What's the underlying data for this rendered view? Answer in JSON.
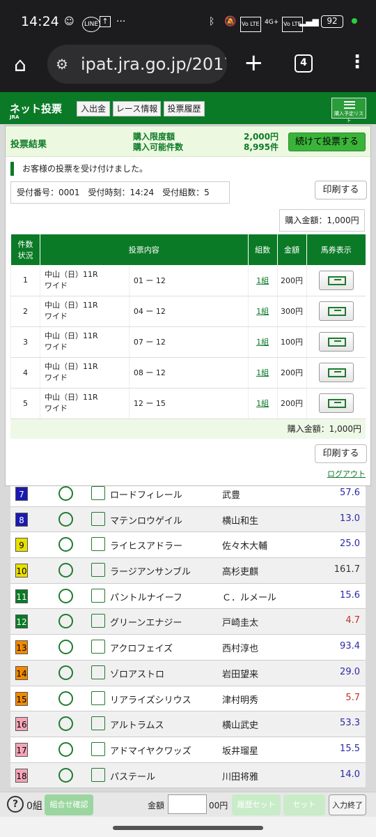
{
  "status": {
    "time": "14:24",
    "battery": "92",
    "net": "4G+"
  },
  "browser": {
    "url": "ipat.jra.go.jp/2017/p",
    "tab_count": "4"
  },
  "jra": {
    "logo": "ネット投票",
    "logo_sub": "JRA",
    "nav": [
      "入出金",
      "レース情報",
      "投票履歴"
    ],
    "list_btn": "購入予定リスト"
  },
  "modal": {
    "title": "投票結果",
    "limit_label": "購入限度額",
    "limit_value": "2,000円",
    "avail_label": "購入可能件数",
    "avail_value": "8,995件",
    "continue_btn": "続けて投票する",
    "accepted": "お客様の投票を受け付けました。",
    "receipt": "受付番号：0001　受付時刻：14:24　受付組数：5",
    "print_btn": "印刷する",
    "amount": "購入金額：1,000円",
    "headers": {
      "n1": "件数",
      "n2": "状況",
      "bet": "投票内容",
      "kumi": "組数",
      "amt": "金額",
      "view": "馬券表示"
    },
    "rows": [
      {
        "n": "1",
        "race": "中山（日）11R",
        "type": "ワイド",
        "combo": "01 ー 12",
        "kumi": "1組",
        "amt": "200円"
      },
      {
        "n": "2",
        "race": "中山（日）11R",
        "type": "ワイド",
        "combo": "04 ー 12",
        "kumi": "1組",
        "amt": "300円"
      },
      {
        "n": "3",
        "race": "中山（日）11R",
        "type": "ワイド",
        "combo": "07 ー 12",
        "kumi": "1組",
        "amt": "100円"
      },
      {
        "n": "4",
        "race": "中山（日）11R",
        "type": "ワイド",
        "combo": "08 ー 12",
        "kumi": "1組",
        "amt": "200円"
      },
      {
        "n": "5",
        "race": "中山（日）11R",
        "type": "ワイド",
        "combo": "12 ー 15",
        "kumi": "1組",
        "amt": "200円"
      }
    ],
    "total": "購入金額：1,000円",
    "print_btn2": "印刷する",
    "logout": "ログアウト"
  },
  "horses": [
    {
      "n": "7",
      "name": "ロードフィレール",
      "jockey": "武豊",
      "odds": "57.6",
      "color": "#1a1ab0",
      "textcolor": "#fff",
      "oddscolor": "#2a2aa8"
    },
    {
      "n": "8",
      "name": "マテンロウゲイル",
      "jockey": "横山和生",
      "odds": "13.0",
      "color": "#1a1ab0",
      "textcolor": "#fff",
      "oddscolor": "#2a2aa8"
    },
    {
      "n": "9",
      "name": "ライヒスアドラー",
      "jockey": "佐々木大輔",
      "odds": "25.0",
      "color": "#e8e000",
      "textcolor": "#000",
      "oddscolor": "#2a2aa8"
    },
    {
      "n": "10",
      "name": "ラージアンサンブル",
      "jockey": "高杉吏麒",
      "odds": "161.7",
      "color": "#e8e000",
      "textcolor": "#000",
      "oddscolor": "#333"
    },
    {
      "n": "11",
      "name": "パントルナイーフ",
      "jockey": "Ｃ．ルメール",
      "odds": "15.6",
      "color": "#0b7a27",
      "textcolor": "#fff",
      "oddscolor": "#2a2aa8"
    },
    {
      "n": "12",
      "name": "グリーンエナジー",
      "jockey": "戸崎圭太",
      "odds": "4.7",
      "color": "#0b7a27",
      "textcolor": "#fff",
      "oddscolor": "#c0302a"
    },
    {
      "n": "13",
      "name": "アクロフェイズ",
      "jockey": "西村淳也",
      "odds": "93.4",
      "color": "#f08a00",
      "textcolor": "#000",
      "oddscolor": "#2a2aa8"
    },
    {
      "n": "14",
      "name": "ゾロアストロ",
      "jockey": "岩田望来",
      "odds": "29.0",
      "color": "#f08a00",
      "textcolor": "#000",
      "oddscolor": "#2a2aa8"
    },
    {
      "n": "15",
      "name": "リアライズシリウス",
      "jockey": "津村明秀",
      "odds": "5.7",
      "color": "#f08a00",
      "textcolor": "#000",
      "oddscolor": "#c0302a"
    },
    {
      "n": "16",
      "name": "アルトラムス",
      "jockey": "横山武史",
      "odds": "53.3",
      "color": "#f4a6b8",
      "textcolor": "#000",
      "oddscolor": "#2a2aa8"
    },
    {
      "n": "17",
      "name": "アドマイヤクワッズ",
      "jockey": "坂井瑠星",
      "odds": "15.5",
      "color": "#f4a6b8",
      "textcolor": "#000",
      "oddscolor": "#2a2aa8"
    },
    {
      "n": "18",
      "name": "パステール",
      "jockey": "川田将雅",
      "odds": "14.0",
      "color": "#f4a6b8",
      "textcolor": "#000",
      "oddscolor": "#2a2aa8"
    }
  ],
  "footer": {
    "count": "0組",
    "confirm": "組合せ確認",
    "amount_label": "金額",
    "unit": "00円",
    "set1": "履歴セット",
    "set2": "セット",
    "end": "入力終了"
  }
}
